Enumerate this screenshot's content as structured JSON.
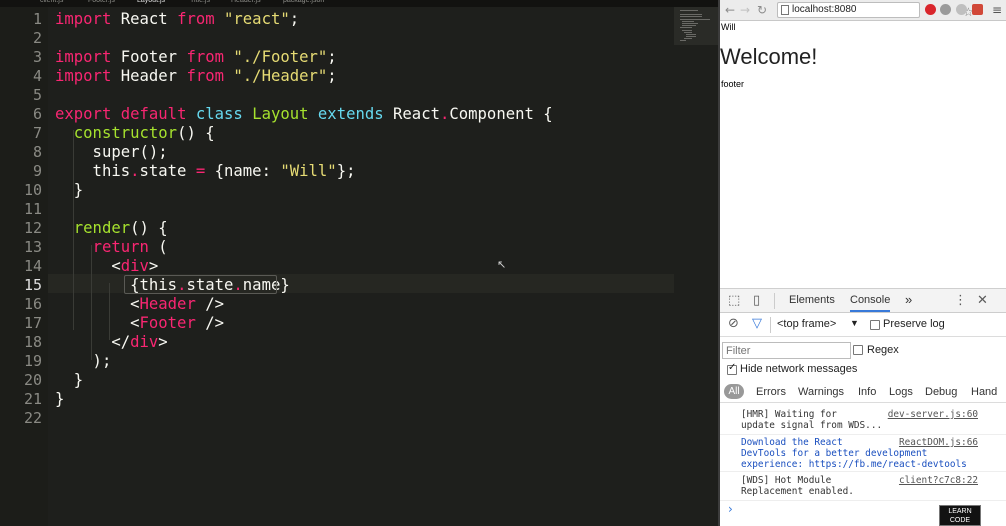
{
  "editor": {
    "tabs": [
      "client.js",
      "Footer.js",
      "Layout.js",
      "Title.js",
      "Header.js",
      "package.json"
    ],
    "active_tab": 2,
    "current_line": 15,
    "lines": [
      [
        [
          "kw",
          "import"
        ],
        [
          "plain",
          " React "
        ],
        [
          "kw",
          "from"
        ],
        [
          "plain",
          " "
        ],
        [
          "str",
          "\"react\""
        ],
        [
          "plain",
          ";"
        ]
      ],
      [],
      [
        [
          "kw",
          "import"
        ],
        [
          "plain",
          " Footer "
        ],
        [
          "kw",
          "from"
        ],
        [
          "plain",
          " "
        ],
        [
          "str",
          "\"./Footer\""
        ],
        [
          "plain",
          ";"
        ]
      ],
      [
        [
          "kw",
          "import"
        ],
        [
          "plain",
          " Header "
        ],
        [
          "kw",
          "from"
        ],
        [
          "plain",
          " "
        ],
        [
          "str",
          "\"./Header\""
        ],
        [
          "plain",
          ";"
        ]
      ],
      [],
      [
        [
          "kw",
          "export"
        ],
        [
          "plain",
          " "
        ],
        [
          "kw",
          "default"
        ],
        [
          "plain",
          " "
        ],
        [
          "cls",
          "class"
        ],
        [
          "plain",
          " "
        ],
        [
          "fn",
          "Layout"
        ],
        [
          "plain",
          " "
        ],
        [
          "cls",
          "extends"
        ],
        [
          "plain",
          " React"
        ],
        [
          "kw",
          "."
        ],
        [
          "plain",
          "Component {"
        ]
      ],
      [
        [
          "plain",
          "  "
        ],
        [
          "fn",
          "constructor"
        ],
        [
          "plain",
          "() {"
        ]
      ],
      [
        [
          "plain",
          "    super();"
        ]
      ],
      [
        [
          "plain",
          "    this"
        ],
        [
          "kw",
          "."
        ],
        [
          "plain",
          "state "
        ],
        [
          "kw",
          "="
        ],
        [
          "plain",
          " {name: "
        ],
        [
          "str",
          "\"Will\""
        ],
        [
          "plain",
          "};"
        ]
      ],
      [
        [
          "plain",
          "  }"
        ]
      ],
      [],
      [
        [
          "plain",
          "  "
        ],
        [
          "fn",
          "render"
        ],
        [
          "plain",
          "() {"
        ]
      ],
      [
        [
          "plain",
          "    "
        ],
        [
          "kw",
          "return"
        ],
        [
          "plain",
          " ("
        ]
      ],
      [
        [
          "plain",
          "      <"
        ],
        [
          "kw",
          "div"
        ],
        [
          "plain",
          ">"
        ]
      ],
      [
        [
          "plain",
          "        {this"
        ],
        [
          "kw",
          "."
        ],
        [
          "plain",
          "state"
        ],
        [
          "kw",
          "."
        ],
        [
          "plain",
          "name}"
        ]
      ],
      [
        [
          "plain",
          "        <"
        ],
        [
          "kw",
          "Header"
        ],
        [
          "plain",
          " />"
        ]
      ],
      [
        [
          "plain",
          "        <"
        ],
        [
          "kw",
          "Footer"
        ],
        [
          "plain",
          " />"
        ]
      ],
      [
        [
          "plain",
          "      </"
        ],
        [
          "kw",
          "div"
        ],
        [
          "plain",
          ">"
        ]
      ],
      [
        [
          "plain",
          "    );"
        ]
      ],
      [
        [
          "plain",
          "  }"
        ]
      ],
      [
        [
          "plain",
          "}"
        ]
      ],
      []
    ]
  },
  "browser": {
    "url": "localhost:8080",
    "page": {
      "name": "Will",
      "heading": "Welcome!",
      "footer": "footer"
    }
  },
  "devtools": {
    "tabs": [
      "Elements",
      "Console"
    ],
    "more": "»",
    "context": "<top frame>",
    "preserve_log": "Preserve log",
    "filter_placeholder": "Filter",
    "regex": "Regex",
    "hide_network": "Hide network messages",
    "levels": [
      "All",
      "Errors",
      "Warnings",
      "Info",
      "Logs",
      "Debug",
      "Hand"
    ],
    "messages": [
      {
        "text": "[HMR] Waiting for\nupdate signal from WDS...",
        "source": "dev-server.js:60",
        "color": "#333333"
      },
      {
        "text": "Download the React\nDevTools for a better development\nexperience: https://fb.me/react-devtools",
        "source": "ReactDOM.js:66",
        "color": "#1a4fbf"
      },
      {
        "text": "[WDS] Hot Module\nReplacement enabled.",
        "source": "client?c7c8:22",
        "color": "#333333"
      }
    ],
    "prompt": "›"
  },
  "badge": {
    "line1": "LEARN",
    "line2": "CODE"
  }
}
